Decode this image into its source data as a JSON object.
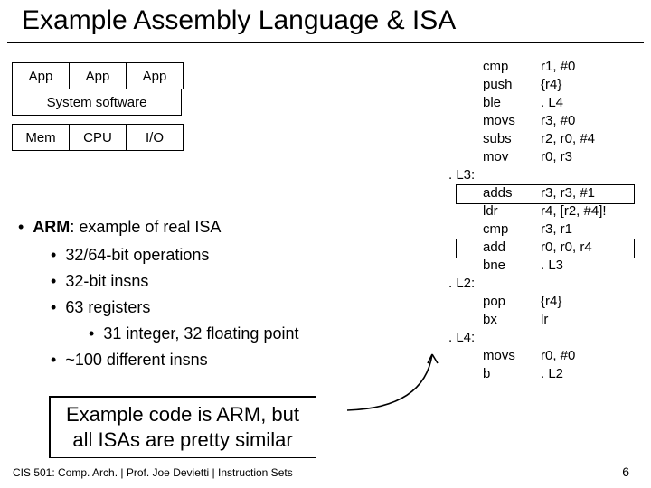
{
  "title": "Example Assembly Language & ISA",
  "stack": {
    "row1": [
      "App",
      "App",
      "App"
    ],
    "row2": "System software",
    "row3": [
      "Mem",
      "CPU",
      "I/O"
    ]
  },
  "bullets": {
    "heading_pre": "ARM",
    "heading_post": ": example of real ISA",
    "b1": "32/64-bit operations",
    "b2": "32-bit insns",
    "b3": "63 registers",
    "b3a": "31 integer, 32 floating point",
    "b4": "~100 different insns"
  },
  "callout_l1": "Example code is ARM, but",
  "callout_l2": "all ISAs are pretty similar",
  "code": [
    {
      "label": "",
      "op": "cmp",
      "arg": "r1, #0"
    },
    {
      "label": "",
      "op": "push",
      "arg": "{r4}"
    },
    {
      "label": "",
      "op": "ble",
      "arg": ". L4"
    },
    {
      "label": "",
      "op": "movs",
      "arg": "r3, #0"
    },
    {
      "label": "",
      "op": "subs",
      "arg": "r2, r0, #4"
    },
    {
      "label": "",
      "op": "mov",
      "arg": "r0, r3"
    },
    {
      "label": ". L3:",
      "op": "",
      "arg": ""
    },
    {
      "label": "",
      "op": "adds",
      "arg": "r3, r3, #1"
    },
    {
      "label": "",
      "op": "ldr",
      "arg": "r4, [r2, #4]!"
    },
    {
      "label": "",
      "op": "cmp",
      "arg": "r3, r1"
    },
    {
      "label": "",
      "op": "add",
      "arg": "r0, r0, r4"
    },
    {
      "label": "",
      "op": "bne",
      "arg": ". L3"
    },
    {
      "label": ". L2:",
      "op": "",
      "arg": ""
    },
    {
      "label": "",
      "op": "pop",
      "arg": "{r4}"
    },
    {
      "label": "",
      "op": "bx",
      "arg": "lr"
    },
    {
      "label": ". L4:",
      "op": "",
      "arg": ""
    },
    {
      "label": "",
      "op": "movs",
      "arg": "r0, #0"
    },
    {
      "label": "",
      "op": "b",
      "arg": ". L2"
    }
  ],
  "footer": "CIS 501: Comp. Arch.  |  Prof. Joe Devietti  |  Instruction Sets",
  "slidenum": "6"
}
